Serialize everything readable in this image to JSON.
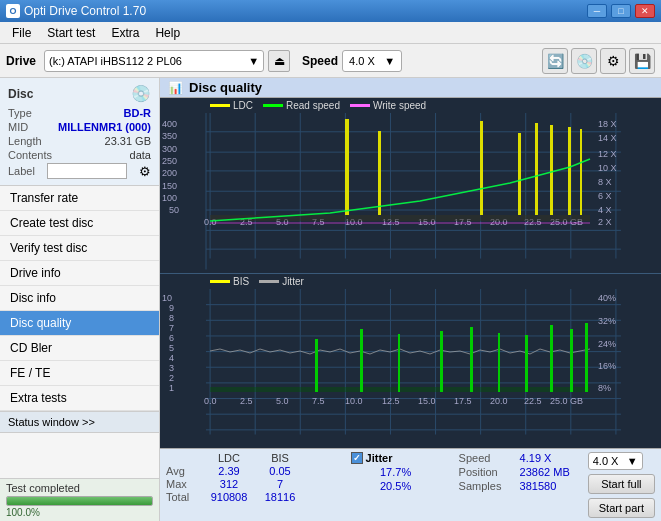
{
  "titleBar": {
    "title": "Opti Drive Control 1.70",
    "minimizeLabel": "─",
    "maximizeLabel": "□",
    "closeLabel": "✕"
  },
  "menuBar": {
    "items": [
      "File",
      "Start test",
      "Extra",
      "Help"
    ]
  },
  "toolbar": {
    "driveLabel": "Drive",
    "driveValue": "(k:)  ATAPI iHBS112  2 PL06",
    "speedLabel": "Speed",
    "speedValue": "4.0 X"
  },
  "discInfo": {
    "sectionTitle": "Disc",
    "typeLabel": "Type",
    "typeValue": "BD-R",
    "midLabel": "MID",
    "midValue": "MILLENMR1 (000)",
    "lengthLabel": "Length",
    "lengthValue": "23.31 GB",
    "contentsLabel": "Contents",
    "contentsValue": "data",
    "labelLabel": "Label"
  },
  "navItems": [
    {
      "id": "transfer-rate",
      "label": "Transfer rate",
      "active": false
    },
    {
      "id": "create-test-disc",
      "label": "Create test disc",
      "active": false
    },
    {
      "id": "verify-test-disc",
      "label": "Verify test disc",
      "active": false
    },
    {
      "id": "drive-info",
      "label": "Drive info",
      "active": false
    },
    {
      "id": "disc-info",
      "label": "Disc info",
      "active": false
    },
    {
      "id": "disc-quality",
      "label": "Disc quality",
      "active": true
    },
    {
      "id": "cd-bler",
      "label": "CD Bler",
      "active": false
    },
    {
      "id": "fe-te",
      "label": "FE / TE",
      "active": false
    },
    {
      "id": "extra-tests",
      "label": "Extra tests",
      "active": false
    }
  ],
  "statusWindow": {
    "label": "Status window >>"
  },
  "chartHeader": {
    "title": "Disc quality"
  },
  "legend": {
    "ldc": {
      "label": "LDC",
      "color": "#ffff00"
    },
    "readSpeed": {
      "label": "Read speed",
      "color": "#00ff00"
    },
    "writeSpeed": {
      "label": "Write speed",
      "color": "#ff66ff"
    }
  },
  "legend2": {
    "bis": {
      "label": "BIS",
      "color": "#ffff00"
    },
    "jitter": {
      "label": "Jitter",
      "color": "#cccccc"
    }
  },
  "upperChart": {
    "yAxisMax": "400",
    "yAxis": [
      "400",
      "350",
      "300",
      "250",
      "200",
      "150",
      "100",
      "50"
    ],
    "xAxis": [
      "0.0",
      "2.5",
      "5.0",
      "7.5",
      "10.0",
      "12.5",
      "15.0",
      "17.5",
      "20.0",
      "22.5",
      "25.0 GB"
    ],
    "rightAxis": [
      "18 X",
      "14 X",
      "12 X",
      "10 X",
      "8 X",
      "6 X",
      "4 X",
      "2 X"
    ]
  },
  "lowerChart": {
    "yAxis": [
      "10",
      "9",
      "8",
      "7",
      "6",
      "5",
      "4",
      "3",
      "2",
      "1"
    ],
    "xAxis": [
      "0.0",
      "2.5",
      "5.0",
      "7.5",
      "10.0",
      "12.5",
      "15.0",
      "17.5",
      "20.0",
      "22.5",
      "25.0 GB"
    ],
    "rightAxis": [
      "40%",
      "32%",
      "24%",
      "16%",
      "8%"
    ]
  },
  "stats": {
    "headers": {
      "ldc": "LDC",
      "bis": "BIS",
      "jitter": "Jitter",
      "speed": "Speed",
      "speedVal": "4.19 X"
    },
    "avg": {
      "label": "Avg",
      "ldc": "2.39",
      "bis": "0.05",
      "jitter": "17.7%"
    },
    "max": {
      "label": "Max",
      "ldc": "312",
      "bis": "7",
      "jitter": "20.5%"
    },
    "total": {
      "label": "Total",
      "ldc": "910808",
      "bis": "18116"
    },
    "position": {
      "label": "Position",
      "value": "23862 MB"
    },
    "samples": {
      "label": "Samples",
      "value": "381580"
    },
    "speedSelectValue": "4.0 X",
    "startFullLabel": "Start full",
    "startPartLabel": "Start part"
  },
  "bottomStatus": {
    "testCompleted": "Test completed",
    "progressPercent": "100.0%",
    "progressWidth": "100"
  }
}
